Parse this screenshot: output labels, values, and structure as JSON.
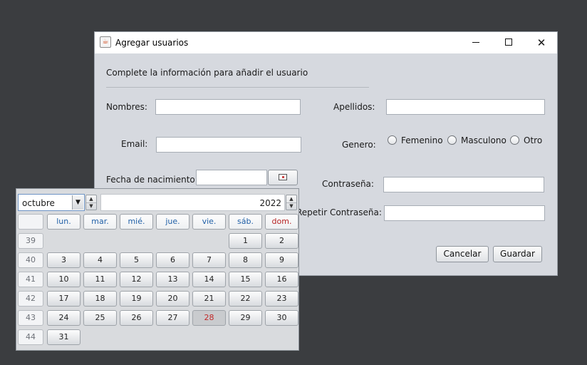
{
  "window": {
    "title": "Agregar usuarios",
    "controls": {
      "minimize": "",
      "maximize": "",
      "close": "✕"
    }
  },
  "form": {
    "heading": "Complete la información para añadir el usuario",
    "nombres_label": "Nombres:",
    "apellidos_label": "Apellidos:",
    "email_label": "Email:",
    "genero_label": "Genero:",
    "genero_options": [
      "Femenino",
      "Masculono",
      "Otro"
    ],
    "fecha_label": "Fecha de nacimiento:",
    "contrasena_label": "Contraseña:",
    "repetir_label": "Repetir Contraseña:",
    "cancel_label": "Cancelar",
    "save_label": "Guardar"
  },
  "calendar": {
    "month": "octubre",
    "year": "2022",
    "weekdays": [
      "lun.",
      "mar.",
      "mié.",
      "jue.",
      "vie.",
      "sáb.",
      "dom."
    ],
    "weeks": [
      {
        "week": "39",
        "days": [
          "",
          "",
          "",
          "",
          "",
          "1",
          "2"
        ]
      },
      {
        "week": "40",
        "days": [
          "3",
          "4",
          "5",
          "6",
          "7",
          "8",
          "9"
        ]
      },
      {
        "week": "41",
        "days": [
          "10",
          "11",
          "12",
          "13",
          "14",
          "15",
          "16"
        ]
      },
      {
        "week": "42",
        "days": [
          "17",
          "18",
          "19",
          "20",
          "21",
          "22",
          "23"
        ]
      },
      {
        "week": "43",
        "days": [
          "24",
          "25",
          "26",
          "27",
          "28",
          "29",
          "30"
        ]
      },
      {
        "week": "44",
        "days": [
          "31",
          "",
          "",
          "",
          "",
          "",
          ""
        ]
      }
    ],
    "selected_day": "28",
    "colors": {
      "weekday_header": "#1f5fa6",
      "sunday_header": "#b52222",
      "selected_day": "#c22a2a"
    }
  }
}
